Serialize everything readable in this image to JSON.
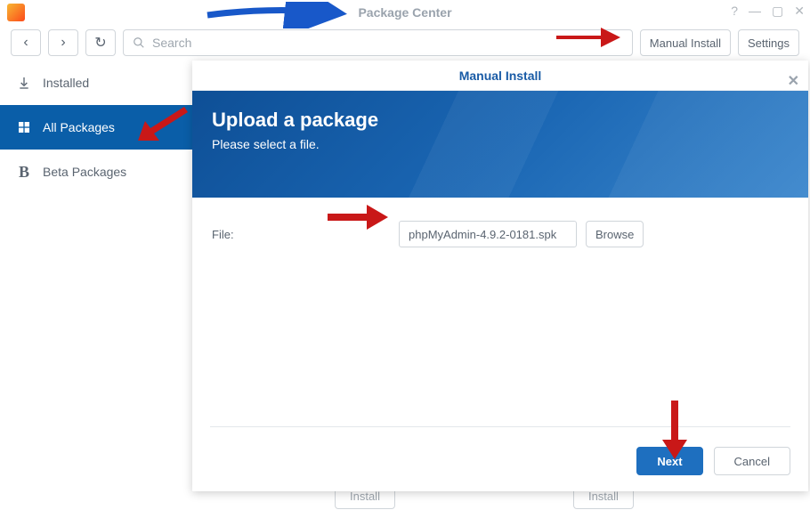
{
  "window": {
    "title": "Package Center"
  },
  "toolbar": {
    "search_placeholder": "Search",
    "manual_install_label": "Manual Install",
    "settings_label": "Settings"
  },
  "sidebar": {
    "items": [
      {
        "label": "Installed"
      },
      {
        "label": "All Packages"
      },
      {
        "label": "Beta Packages"
      }
    ]
  },
  "content": {
    "install_label": "Install"
  },
  "modal": {
    "title": "Manual Install",
    "heading": "Upload a package",
    "subheading": "Please select a file.",
    "file_label": "File:",
    "file_value": "phpMyAdmin-4.9.2-0181.spk",
    "browse_label": "Browse",
    "next_label": "Next",
    "cancel_label": "Cancel"
  }
}
